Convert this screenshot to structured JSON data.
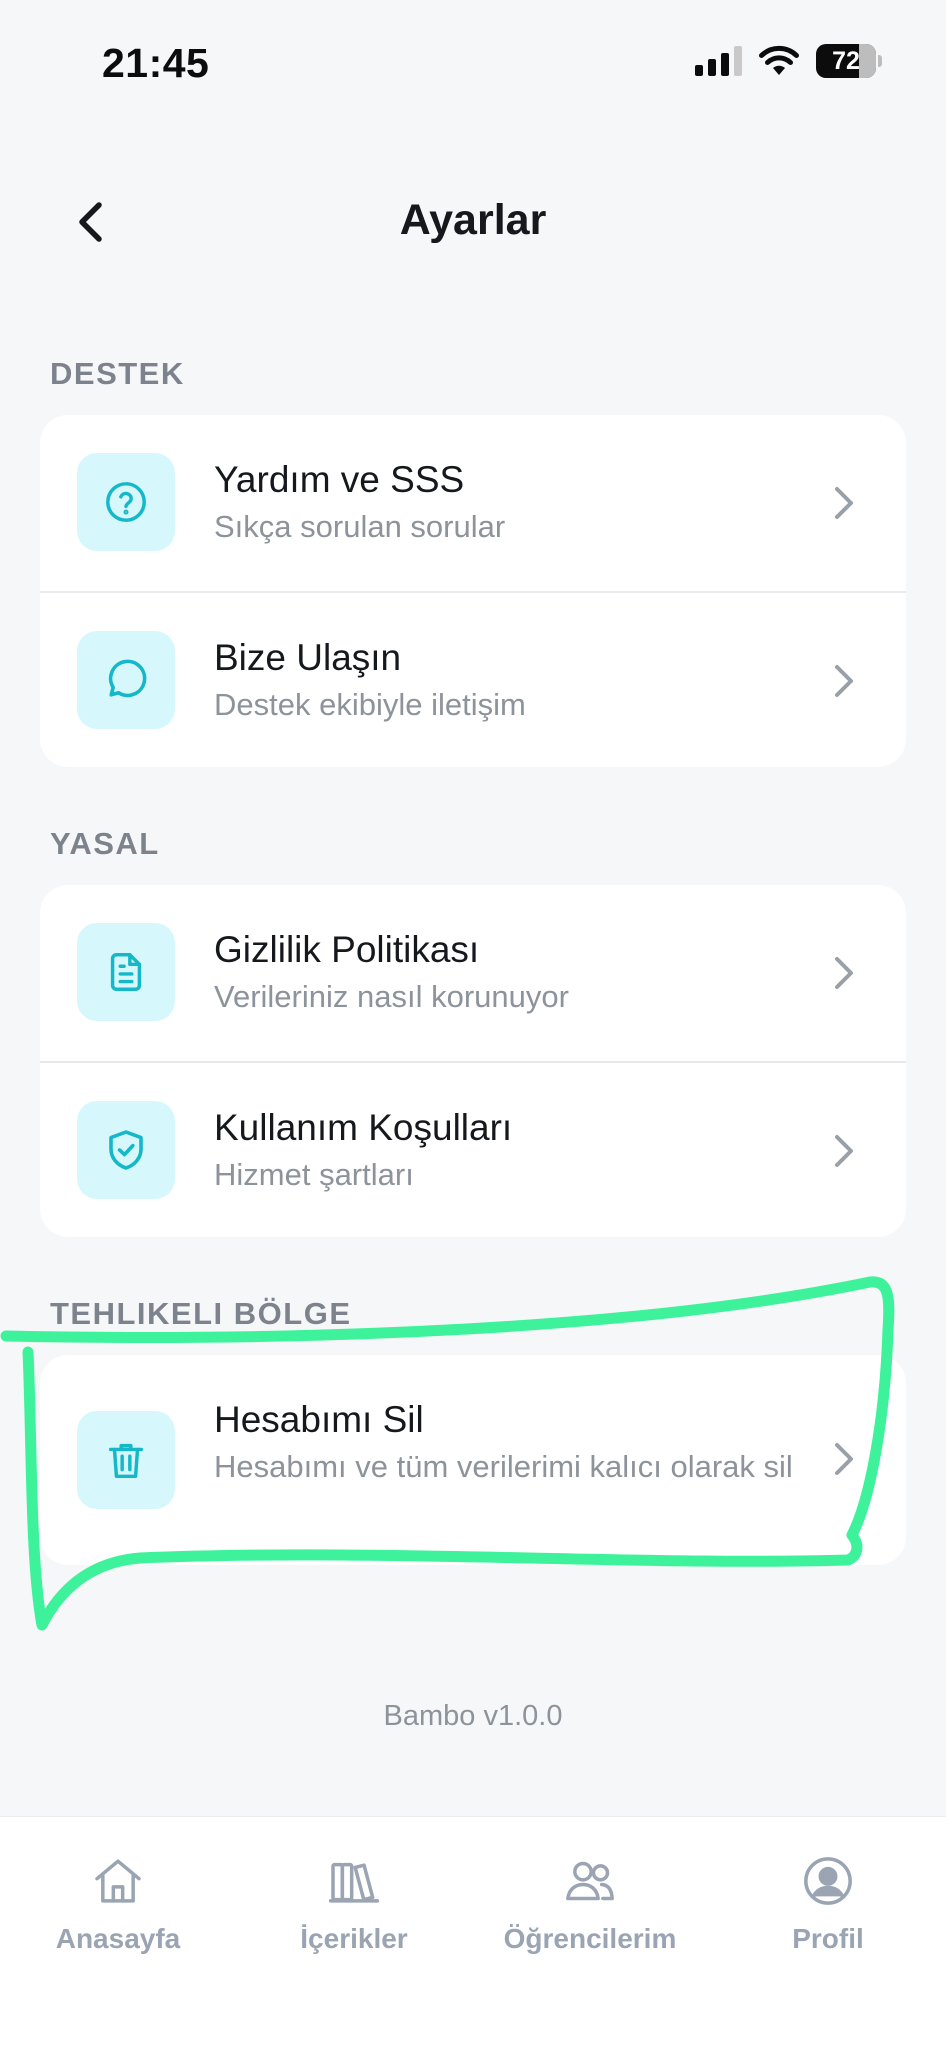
{
  "status_bar": {
    "time": "21:45",
    "battery": "72",
    "battery_level": 0.72
  },
  "header": {
    "title": "Ayarlar"
  },
  "sections": [
    {
      "label": "DESTEK",
      "items": [
        {
          "title": "Yardım ve SSS",
          "subtitle": "Sıkça sorulan sorular",
          "icon": "help-circle-icon"
        },
        {
          "title": "Bize Ulaşın",
          "subtitle": "Destek ekibiyle iletişim",
          "icon": "chat-bubble-icon"
        }
      ]
    },
    {
      "label": "YASAL",
      "items": [
        {
          "title": "Gizlilik Politikası",
          "subtitle": "Verileriniz nasıl korunuyor",
          "icon": "document-icon"
        },
        {
          "title": "Kullanım Koşulları",
          "subtitle": "Hizmet şartları",
          "icon": "shield-check-icon"
        }
      ]
    },
    {
      "label": "TEHLIKELI BÖLGE",
      "items": [
        {
          "title": "Hesabımı Sil",
          "subtitle": "Hesabımı ve tüm verilerimi kalıcı olarak sil",
          "icon": "trash-icon"
        }
      ]
    }
  ],
  "footer": {
    "version": "Bambo v1.0.0"
  },
  "tab_bar": {
    "tabs": [
      {
        "label": "Anasayfa",
        "icon": "home-icon"
      },
      {
        "label": "İçerikler",
        "icon": "library-icon"
      },
      {
        "label": "Öğrencilerim",
        "icon": "users-icon"
      },
      {
        "label": "Profil",
        "icon": "user-circle-icon"
      }
    ]
  },
  "colors": {
    "accent": "#14b8c8",
    "icon_tile": "#d6f8fc",
    "annotation_stroke": "#3df29a",
    "tab_inactive": "#9aa4b2"
  }
}
